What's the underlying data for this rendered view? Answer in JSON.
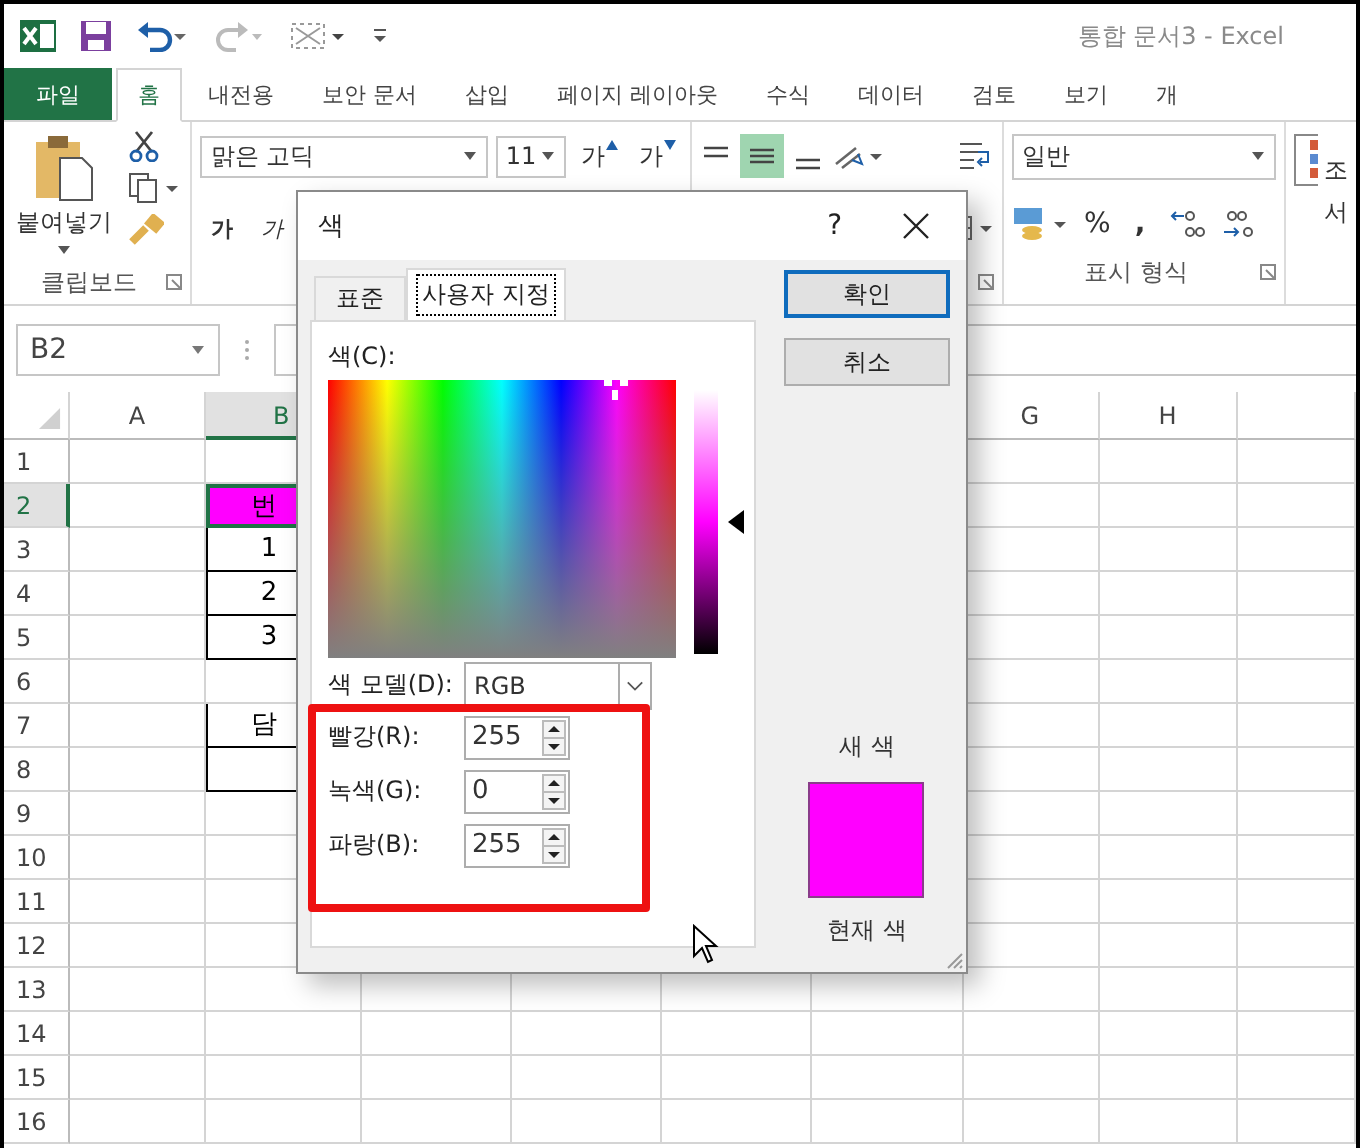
{
  "window": {
    "title": "통합 문서3 - Excel"
  },
  "ribbon_tabs": [
    {
      "label": "파일",
      "kind": "file",
      "selected": false
    },
    {
      "label": "홈",
      "kind": "tab",
      "selected": true
    },
    {
      "label": "내전용",
      "kind": "tab",
      "selected": false
    },
    {
      "label": "보안 문서",
      "kind": "tab",
      "selected": false
    },
    {
      "label": "삽입",
      "kind": "tab",
      "selected": false
    },
    {
      "label": "페이지 레이아웃",
      "kind": "tab",
      "selected": false
    },
    {
      "label": "수식",
      "kind": "tab",
      "selected": false
    },
    {
      "label": "데이터",
      "kind": "tab",
      "selected": false
    },
    {
      "label": "검토",
      "kind": "tab",
      "selected": false
    },
    {
      "label": "보기",
      "kind": "tab",
      "selected": false
    },
    {
      "label": "개",
      "kind": "tab",
      "selected": false
    }
  ],
  "ribbon": {
    "clipboard": {
      "paste": "붙여넣기",
      "group_label": "클립보드"
    },
    "font": {
      "name": "맑은 고딕",
      "size": "11",
      "grow": "가",
      "shrink": "가",
      "bold": "가",
      "italic": "가"
    },
    "number": {
      "format": "일반",
      "percent": "%",
      "comma": ",",
      "group_label": "표시 형식"
    },
    "styles_lines": [
      "조",
      "서"
    ]
  },
  "name_box": "B2",
  "sheet": {
    "left_columns": [
      {
        "label": "A",
        "selected": false
      },
      {
        "label": "B",
        "selected": true
      }
    ],
    "right_columns": [
      {
        "label": "G",
        "selected": false
      },
      {
        "label": "H",
        "selected": false
      }
    ],
    "rows": [
      {
        "number": "1",
        "selected": false,
        "bordered": false
      },
      {
        "number": "2",
        "selected": true,
        "bordered": true,
        "b": "번",
        "color": "#ff00ff"
      },
      {
        "number": "3",
        "selected": false,
        "bordered": true,
        "b": "1"
      },
      {
        "number": "4",
        "selected": false,
        "bordered": true,
        "b": "2"
      },
      {
        "number": "5",
        "selected": false,
        "bordered": true,
        "b": "3"
      },
      {
        "number": "6",
        "selected": false,
        "bordered": false
      },
      {
        "number": "7",
        "selected": false,
        "bordered": true,
        "b": "담"
      },
      {
        "number": "8",
        "selected": false,
        "bordered": true
      },
      {
        "number": "9",
        "selected": false,
        "bordered": false
      },
      {
        "number": "10",
        "selected": false,
        "bordered": false
      },
      {
        "number": "11",
        "selected": false,
        "bordered": false
      },
      {
        "number": "12",
        "selected": false,
        "bordered": false
      },
      {
        "number": "13",
        "selected": false,
        "bordered": false
      },
      {
        "number": "14",
        "selected": false,
        "bordered": false
      },
      {
        "number": "15",
        "selected": false,
        "bordered": false
      },
      {
        "number": "16",
        "selected": false,
        "bordered": false
      }
    ]
  },
  "dialog": {
    "title": "색",
    "help": "?",
    "tabs": [
      {
        "label": "표준",
        "selected": false
      },
      {
        "label": "사용자 지정",
        "selected": true
      }
    ],
    "buttons": [
      {
        "label": "확인",
        "default": true
      },
      {
        "label": "취소",
        "default": false
      }
    ],
    "color_label": "색(C):",
    "luminance": {
      "level": 0.5
    },
    "model_label": "색 모델(D):",
    "model": "RGB",
    "channels": [
      {
        "label": "빨강(R):",
        "value": "255"
      },
      {
        "label": "녹색(G):",
        "value": "0"
      },
      {
        "label": "파랑(B):",
        "value": "255"
      }
    ],
    "new_label": "새 색",
    "current_label": "현재 색"
  }
}
